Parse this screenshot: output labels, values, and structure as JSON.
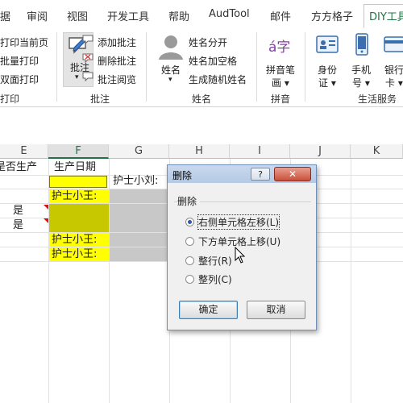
{
  "ribbon_tabs": [
    "据",
    "审阅",
    "视图",
    "开发工具",
    "帮助",
    "AudTool",
    "邮件",
    "方方格子",
    "DIY工具"
  ],
  "ribbon": {
    "print_group": {
      "items": [
        "打印当前页",
        "批量打印",
        "双面打印"
      ],
      "label": "打印"
    },
    "annotation_group": {
      "big_button": "批注",
      "big_button_arrow": "▾",
      "items": [
        "添加批注",
        "删除批注",
        "批注阅览"
      ],
      "label": "批注"
    },
    "name_group": {
      "big_button": "姓名",
      "big_button_arrow": "▾",
      "items": [
        "姓名分开",
        "姓名加空格",
        "生成随机姓名"
      ],
      "label": "姓名"
    },
    "pinyin_group": {
      "icon_glyph": "á字",
      "big_button_line1": "拼音笔",
      "big_button_line2": "画 ▾",
      "label": "拼音"
    },
    "life_group": {
      "buttons": [
        {
          "line1": "身份",
          "line2": "证 ▾"
        },
        {
          "line1": "手机",
          "line2": "号 ▾"
        },
        {
          "line1": "银行",
          "line2": "卡 ▾"
        }
      ],
      "label": "生活服务"
    }
  },
  "sheet": {
    "columns": [
      "E",
      "F",
      "G",
      "H",
      "I",
      "J",
      "K"
    ],
    "header_row": {
      "E": "是否生产",
      "F": "生产日期"
    },
    "overflow_text": "护士小刘:",
    "f_cells": [
      "护士小王:",
      "护士小王:",
      "护士小王:"
    ],
    "e_cells": [
      "是",
      "是"
    ]
  },
  "dialog": {
    "title": "删除",
    "help": "?",
    "close": "✕",
    "group_label": "删除",
    "options": [
      "右侧单元格左移(L)",
      "下方单元格上移(U)",
      "整行(R)",
      "整列(C)"
    ],
    "selected_index": 0,
    "ok": "确定",
    "cancel": "取消"
  }
}
